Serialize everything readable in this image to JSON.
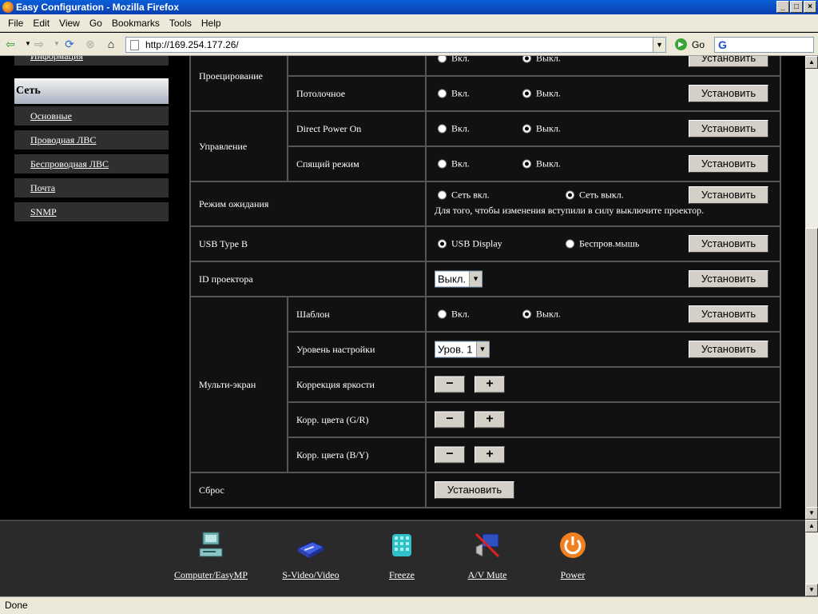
{
  "window": {
    "title": "Easy Configuration - Mozilla Firefox"
  },
  "menubar": {
    "items": [
      "File",
      "Edit",
      "View",
      "Go",
      "Bookmarks",
      "Tools",
      "Help"
    ]
  },
  "navbar": {
    "url": "http://169.254.177.26/",
    "go_label": "Go",
    "search_logo": "G"
  },
  "sidebar": {
    "top_partial": "Информация",
    "section": "Сеть",
    "items": [
      "Основные",
      "Проводная ЛВС",
      "Беспроводная ЛВС",
      "Почта",
      "SNMP"
    ]
  },
  "settings": {
    "set_label": "Установить",
    "projection": {
      "group": "Проецирование",
      "row1_on": "Вкл.",
      "row1_off": "Выкл.",
      "row2_label": "Потолочное",
      "row2_on": "Вкл.",
      "row2_off": "Выкл."
    },
    "control": {
      "group": "Управление",
      "row1_label": "Direct Power On",
      "row1_on": "Вкл.",
      "row1_off": "Выкл.",
      "row2_label": "Спящий режим",
      "row2_on": "Вкл.",
      "row2_off": "Выкл."
    },
    "standby": {
      "label": "Режим ожидания",
      "opt1": "Сеть вкл.",
      "opt2": "Сеть выкл.",
      "note": "Для того, чтобы изменения вступили в силу выключите проектор."
    },
    "usb": {
      "label": "USB Type B",
      "opt1": "USB Display",
      "opt2": "Беспров.мышь"
    },
    "projector_id": {
      "label": "ID проектора",
      "value": "Выкл."
    },
    "multiscreen": {
      "group": "Мульти-экран",
      "template_label": "Шаблон",
      "template_on": "Вкл.",
      "template_off": "Выкл.",
      "level_label": "Уровень настройки",
      "level_value": "Уров. 1",
      "brightness_label": "Коррекция яркости",
      "color_gr_label": "Корр. цвета (G/R)",
      "color_by_label": "Корр. цвета (B/Y)",
      "minus": "−",
      "plus": "+"
    },
    "reset": {
      "label": "Сброс"
    }
  },
  "bottom": {
    "items": [
      "Computer/EasyMP",
      "S-Video/Video",
      "Freeze",
      "A/V Mute",
      "Power"
    ]
  },
  "status": {
    "text": "Done"
  },
  "colors": {
    "accent": "#0a3fb0",
    "panel": "#111111",
    "border": "#555555"
  }
}
